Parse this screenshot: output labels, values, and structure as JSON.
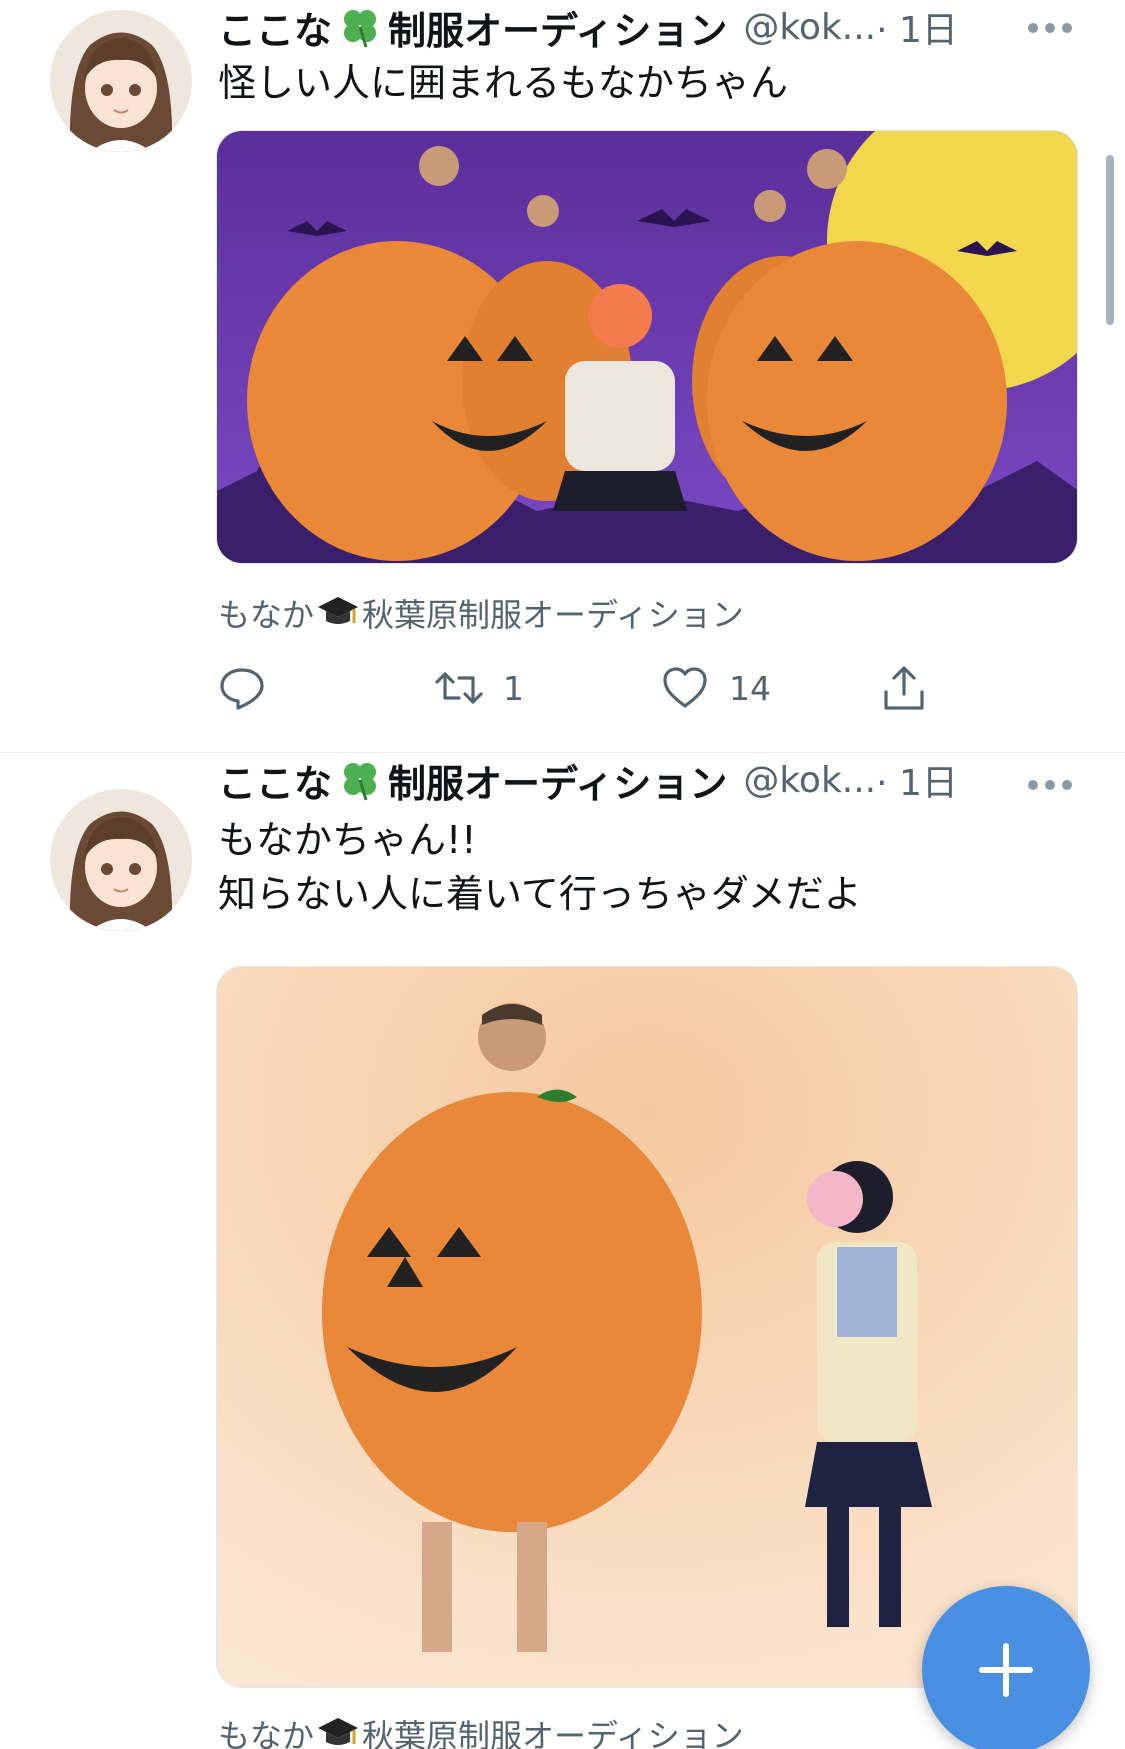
{
  "tweets": [
    {
      "name_left": "ここな",
      "name_right": "制服オーディション",
      "handle": "@kok...",
      "time": "· 1日",
      "text": [
        "怪しい人に囲まれるもなかちゃん"
      ],
      "tags_left": "もなか",
      "tags_right": "秋葉原制服オーディション",
      "actions": {
        "reply": "",
        "retweet": "1",
        "like": "14"
      }
    },
    {
      "name_left": "ここな",
      "name_right": "制服オーディション",
      "handle": "@kok...",
      "time": "· 1日",
      "text": [
        "もなかちゃん!!",
        "知らない人に着いて行っちゃダメだよ"
      ],
      "tags_left": "もなか",
      "tags_right": "秋葉原制服オーディション"
    }
  ],
  "icons": {
    "more": "more-icon",
    "clover": "four-leaf-clover-icon",
    "cap": "graduation-cap-icon",
    "reply": "reply-icon",
    "retweet": "retweet-icon",
    "like": "heart-icon",
    "share": "share-icon",
    "compose": "plus-icon"
  },
  "colors": {
    "accent": "#1d9bf0",
    "fab": "#4a90e2",
    "secondary_text": "#536471"
  }
}
